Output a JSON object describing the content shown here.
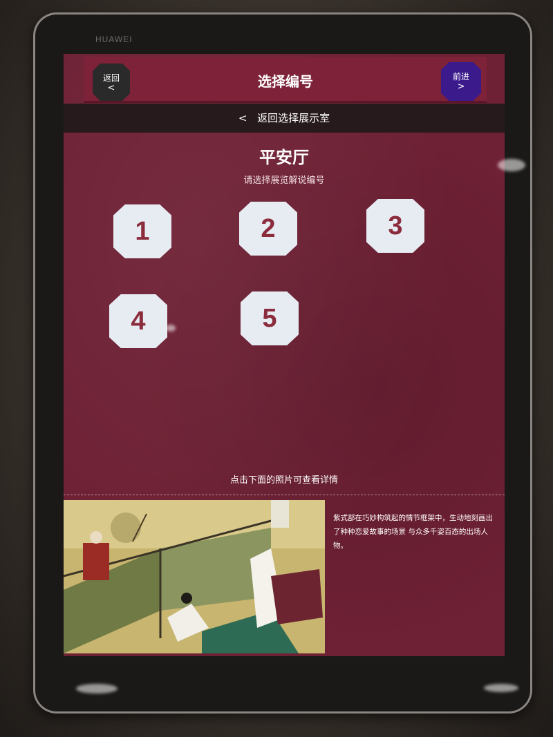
{
  "device": {
    "brand": "HUAWEI"
  },
  "header": {
    "back_label": "返回",
    "back_arrow": "<",
    "title": "选择编号",
    "forward_label": "前进",
    "forward_arrow": ">"
  },
  "room_nav": {
    "chevron": "<",
    "label": "返回选择展示室"
  },
  "hall": {
    "name": "平安厅",
    "prompt": "请选择展览解说编号"
  },
  "numbers": [
    "1",
    "2",
    "3",
    "4",
    "5"
  ],
  "gallery": {
    "hint": "点击下面的照片可查看详情",
    "description": "紫式部在巧妙构筑起的情节框架中，生动地刻画出了种种恋爱故事的场景 与众多千姿百态的出场人物。"
  },
  "colors": {
    "screen_bg": "#6e2034",
    "header_bg": "#7d2238",
    "back_button": "#2a2a2a",
    "forward_button": "#3b1a8c",
    "number_button_bg": "#e7ecf3",
    "number_text": "#8b2c3d"
  }
}
